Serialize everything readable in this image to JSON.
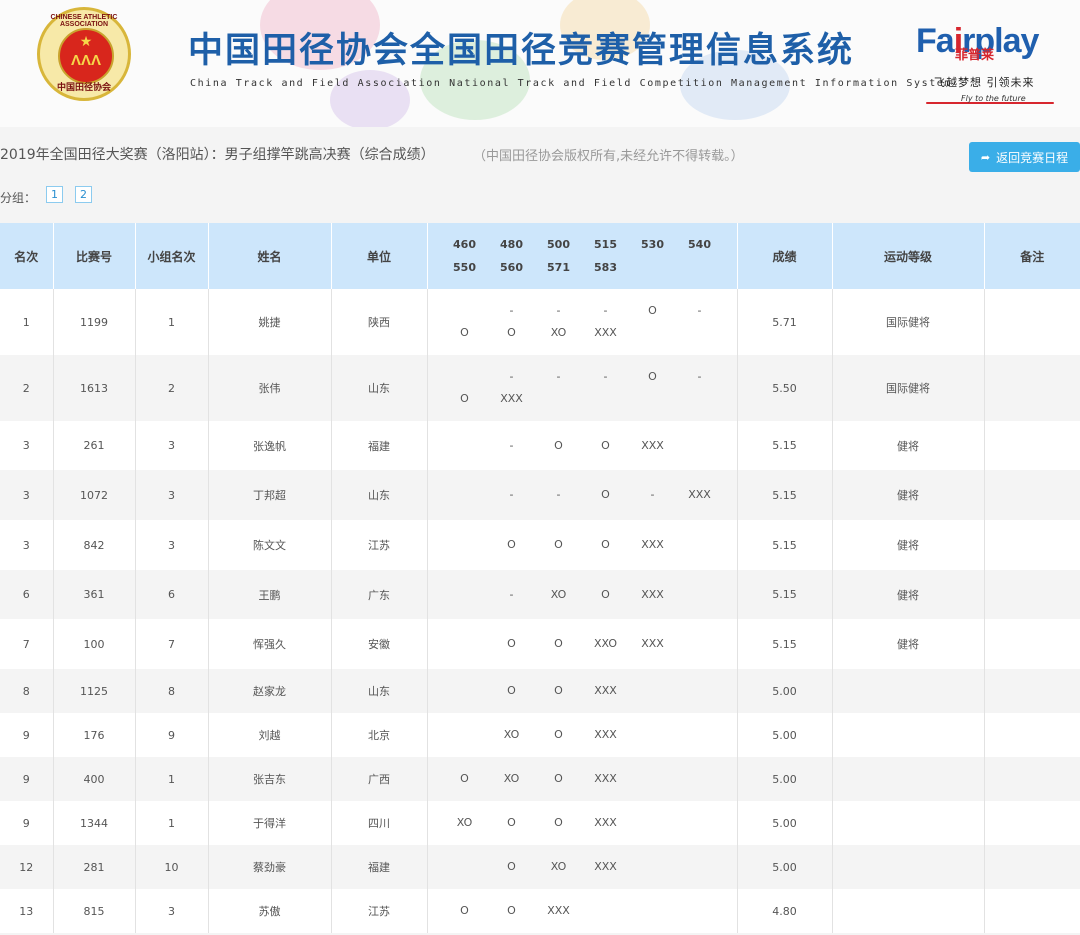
{
  "header": {
    "emblem_top_text": "CHINESE ATHLETIC ASSOCIATION",
    "emblem_mark": "ΛΛΛ",
    "emblem_bottom_text": "中国田径协会",
    "title_cn": "中国田径协会全国田径竞赛管理信息系统",
    "title_en": "China Track and Field Association National Track and Field Competition Management Information System",
    "sponsor_logo": {
      "left": "Fa",
      "accent": "i",
      "right": "rplay"
    },
    "sponsor_cn": "菲普莱",
    "sponsor_slogan": "飞越梦想  引领未来",
    "sponsor_en": "Fly to the future"
  },
  "page": {
    "title": "2019年全国田径大奖赛（洛阳站）：男子组撑竿跳高决赛（综合成绩）",
    "copyright": "（中国田径协会版权所有,未经允许不得转载。）",
    "back_button": "返回竞赛日程",
    "group_label": "分组：",
    "groups": [
      "1",
      "2"
    ]
  },
  "table": {
    "columns": [
      "名次",
      "比赛号",
      "小组名次",
      "姓名",
      "单位",
      "",
      "成绩",
      "运动等级",
      "备注"
    ],
    "heights": [
      [
        "460",
        "480",
        "500",
        "515",
        "530",
        "540"
      ],
      [
        "550",
        "560",
        "571",
        "583",
        "",
        ""
      ]
    ],
    "rows": [
      {
        "rank": "1",
        "bib": "1199",
        "group_rank": "1",
        "name": "姚捷",
        "unit": "陕西",
        "attempts": [
          [
            "",
            "-",
            "-",
            "-",
            "O",
            "-"
          ],
          [
            "O",
            "O",
            "XO",
            "XXX",
            "",
            ""
          ]
        ],
        "result": "5.71",
        "grade": "国际健将",
        "note": ""
      },
      {
        "rank": "2",
        "bib": "1613",
        "group_rank": "2",
        "name": "张伟",
        "unit": "山东",
        "attempts": [
          [
            "",
            "-",
            "-",
            "-",
            "O",
            "-"
          ],
          [
            "O",
            "XXX",
            "",
            "",
            "",
            ""
          ]
        ],
        "result": "5.50",
        "grade": "国际健将",
        "note": ""
      },
      {
        "rank": "3",
        "bib": "261",
        "group_rank": "3",
        "name": "张逸帆",
        "unit": "福建",
        "attempts": [
          [
            "",
            "-",
            "O",
            "O",
            "XXX",
            ""
          ]
        ],
        "result": "5.15",
        "grade": "健将",
        "note": ""
      },
      {
        "rank": "3",
        "bib": "1072",
        "group_rank": "3",
        "name": "丁邦超",
        "unit": "山东",
        "attempts": [
          [
            "",
            "-",
            "-",
            "O",
            "-",
            "XXX"
          ]
        ],
        "result": "5.15",
        "grade": "健将",
        "note": ""
      },
      {
        "rank": "3",
        "bib": "842",
        "group_rank": "3",
        "name": "陈文文",
        "unit": "江苏",
        "attempts": [
          [
            "",
            "O",
            "O",
            "O",
            "XXX",
            ""
          ]
        ],
        "result": "5.15",
        "grade": "健将",
        "note": ""
      },
      {
        "rank": "6",
        "bib": "361",
        "group_rank": "6",
        "name": "王鹏",
        "unit": "广东",
        "attempts": [
          [
            "",
            "-",
            "XO",
            "O",
            "XXX",
            ""
          ]
        ],
        "result": "5.15",
        "grade": "健将",
        "note": ""
      },
      {
        "rank": "7",
        "bib": "100",
        "group_rank": "7",
        "name": "恽强久",
        "unit": "安徽",
        "attempts": [
          [
            "",
            "O",
            "O",
            "XXO",
            "XXX",
            ""
          ]
        ],
        "result": "5.15",
        "grade": "健将",
        "note": ""
      },
      {
        "rank": "8",
        "bib": "1125",
        "group_rank": "8",
        "name": "赵家龙",
        "unit": "山东",
        "attempts": [
          [
            "",
            "O",
            "O",
            "XXX",
            "",
            ""
          ]
        ],
        "result": "5.00",
        "grade": "",
        "note": ""
      },
      {
        "rank": "9",
        "bib": "176",
        "group_rank": "9",
        "name": "刘越",
        "unit": "北京",
        "attempts": [
          [
            "",
            "XO",
            "O",
            "XXX",
            "",
            ""
          ]
        ],
        "result": "5.00",
        "grade": "",
        "note": ""
      },
      {
        "rank": "9",
        "bib": "400",
        "group_rank": "1",
        "name": "张吉东",
        "unit": "广西",
        "attempts": [
          [
            "O",
            "XO",
            "O",
            "XXX",
            "",
            ""
          ]
        ],
        "result": "5.00",
        "grade": "",
        "note": ""
      },
      {
        "rank": "9",
        "bib": "1344",
        "group_rank": "1",
        "name": "于得洋",
        "unit": "四川",
        "attempts": [
          [
            "XO",
            "O",
            "O",
            "XXX",
            "",
            ""
          ]
        ],
        "result": "5.00",
        "grade": "",
        "note": ""
      },
      {
        "rank": "12",
        "bib": "281",
        "group_rank": "10",
        "name": "蔡劲豪",
        "unit": "福建",
        "attempts": [
          [
            "",
            "O",
            "XO",
            "XXX",
            "",
            ""
          ]
        ],
        "result": "5.00",
        "grade": "",
        "note": ""
      },
      {
        "rank": "13",
        "bib": "815",
        "group_rank": "3",
        "name": "苏傲",
        "unit": "江苏",
        "attempts": [
          [
            "O",
            "O",
            "XXX",
            "",
            "",
            ""
          ]
        ],
        "result": "4.80",
        "grade": "",
        "note": ""
      }
    ]
  }
}
